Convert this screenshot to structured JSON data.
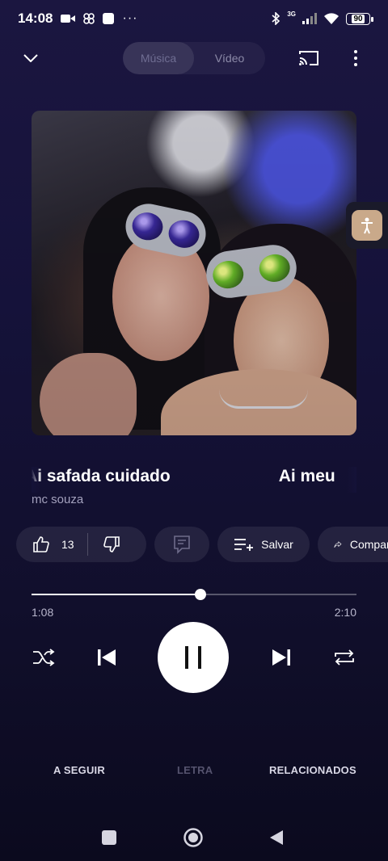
{
  "status_bar": {
    "time": "14:08",
    "network": "3G",
    "battery": "90"
  },
  "top_bar": {
    "tab_music": "Música",
    "tab_video": "Vídeo"
  },
  "player": {
    "title": "Ai safada cuidado",
    "title_next": "Ai meu",
    "artist": "mc souza",
    "likes": "13",
    "save_label": "Salvar",
    "share_label": "Compartilhar",
    "current_time": "1:08",
    "duration": "2:10",
    "progress": 0.52
  },
  "bottom_tabs": {
    "up_next": "A SEGUIR",
    "lyrics": "LETRA",
    "related": "RELACIONADOS"
  },
  "colors": {
    "background": "#15123a",
    "pill": "#25223f",
    "accent": "#ffffff"
  }
}
